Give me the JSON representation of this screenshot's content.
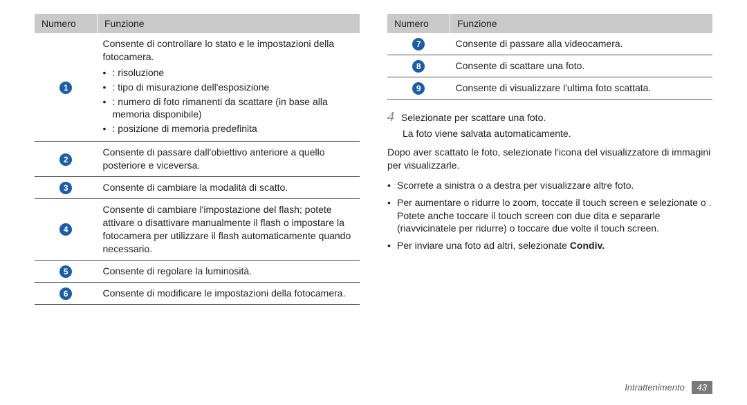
{
  "left_table": {
    "headers": {
      "num": "Numero",
      "func": "Funzione"
    },
    "rows": [
      {
        "num": "1",
        "intro": "Consente di controllare lo stato e le impostazioni della fotocamera.",
        "bullets": [
          "  : risoluzione",
          "  : tipo di misurazione dell'esposizione",
          "  : numero di foto rimanenti da scattare (in base alla memoria disponibile)",
          "  : posizione di memoria predefinita"
        ]
      },
      {
        "num": "2",
        "text": "Consente di passare dall'obiettivo anteriore a quello posteriore e viceversa."
      },
      {
        "num": "3",
        "text": "Consente di cambiare la modalità di scatto."
      },
      {
        "num": "4",
        "text": "Consente di cambiare l'impostazione del flash; potete attivare o disattivare manualmente il flash o impostare la fotocamera per utilizzare il flash automaticamente quando necessario."
      },
      {
        "num": "5",
        "text": "Consente di regolare la luminosità."
      },
      {
        "num": "6",
        "text": "Consente di modificare le impostazioni della fotocamera."
      }
    ]
  },
  "right_table": {
    "headers": {
      "num": "Numero",
      "func": "Funzione"
    },
    "rows": [
      {
        "num": "7",
        "text": "Consente di passare alla videocamera."
      },
      {
        "num": "8",
        "text": "Consente di scattare una foto."
      },
      {
        "num": "9",
        "text": "Consente di visualizzare l'ultima foto scattata."
      }
    ]
  },
  "step": {
    "number": "4",
    "text": "Selezionate        per scattare una foto.",
    "subtext": "La foto viene salvata automaticamente."
  },
  "after_paragraph": "Dopo aver scattato le foto, selezionate l'icona del visualizzatore di immagini per visualizzarle.",
  "tips": [
    {
      "text": "Scorrete a sinistra o a destra per visualizzare altre foto."
    },
    {
      "text": "Per aumentare o ridurre lo zoom, toccate il touch screen e selezionate      o     . Potete anche toccare il touch screen con due dita e separarle (riavvicinatele per ridurre) o toccare due volte il touch screen."
    },
    {
      "text_prefix": "Per inviare una foto ad altri, selezionate ",
      "bold": "Condiv."
    }
  ],
  "footer": {
    "label": "Intrattenimento",
    "page": "43"
  }
}
